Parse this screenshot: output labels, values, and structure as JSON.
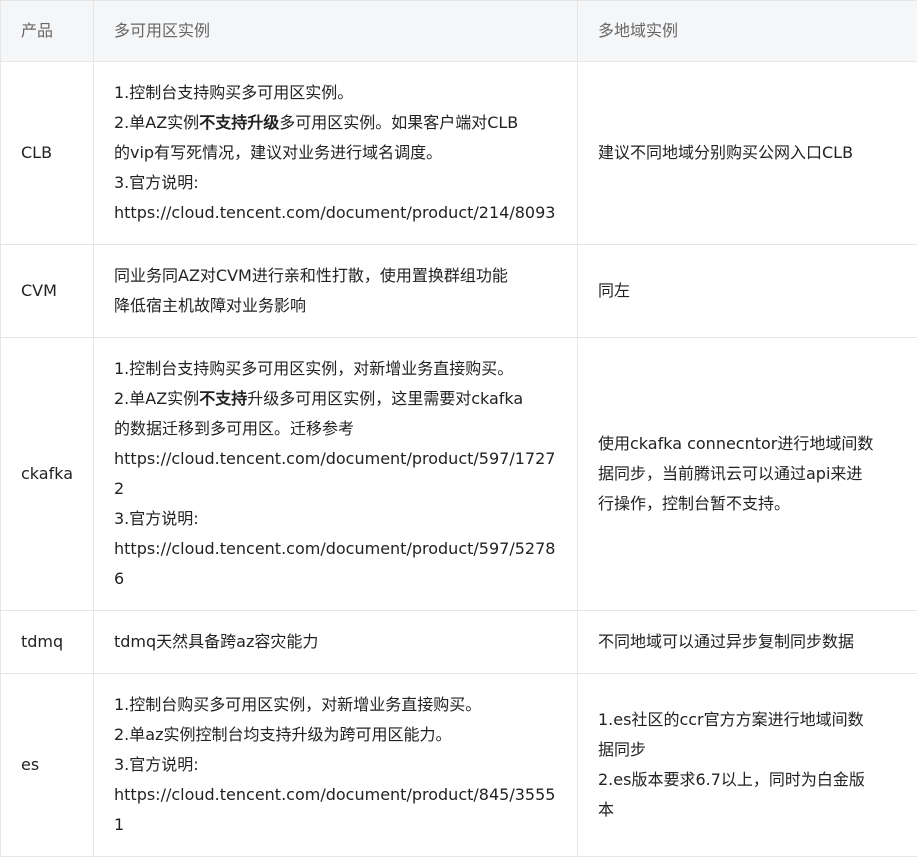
{
  "header": {
    "col_product": "产品",
    "col_multi_az": "多可用区实例",
    "col_multi_region": "多地域实例"
  },
  "rows": [
    {
      "product": "CLB",
      "az_lines": [
        [
          "1.控制台支持购买多可用区实例。"
        ],
        [
          "2.单AZ实例",
          "不支持升级",
          "多可用区实例。如果客户端对CLB"
        ],
        [
          "的vip有写死情况，建议对业务进行域名调度。"
        ],
        [
          "3.官方说明:"
        ],
        [
          "https://cloud.tencent.com/document/product/214/8093"
        ]
      ],
      "region_lines": [
        "建议不同地域分别购买公网入口CLB"
      ]
    },
    {
      "product": "CVM",
      "az_lines": [
        [
          "同业务同AZ对CVM进行亲和性打散，使用置换群组功能"
        ],
        [
          "降低宿主机故障对业务影响"
        ]
      ],
      "region_lines": [
        "同左"
      ]
    },
    {
      "product": "ckafka",
      "az_lines": [
        [
          "1.控制台支持购买多可用区实例，对新增业务直接购买。"
        ],
        [
          "2.单AZ实例",
          "不支持",
          "升级多可用区实例，这里需要对ckafka"
        ],
        [
          "的数据迁移到多可用区。迁移参考"
        ],
        [
          "https://cloud.tencent.com/document/product/597/17272"
        ],
        [
          "3.官方说明:"
        ],
        [
          "https://cloud.tencent.com/document/product/597/52786"
        ]
      ],
      "region_lines": [
        "使用ckafka connecntor进行地域间数",
        "据同步，当前腾讯云可以通过api来进",
        "行操作，控制台暂不支持。"
      ]
    },
    {
      "product": "tdmq",
      "az_lines": [
        [
          "tdmq天然具备跨az容灾能力"
        ]
      ],
      "region_lines": [
        "不同地域可以通过异步复制同步数据"
      ]
    },
    {
      "product": "es",
      "az_lines": [
        [
          "1.控制台购买多可用区实例，对新增业务直接购买。"
        ],
        [
          "2.单az实例控制台均支持升级为跨可用区能力。"
        ],
        [
          "3.官方说明:"
        ],
        [
          "https://cloud.tencent.com/document/product/845/35551"
        ]
      ],
      "region_lines": [
        "1.es社区的ccr官方方案进行地域间数",
        "据同步",
        "2.es版本要求6.7以上，同时为白金版",
        "本"
      ]
    }
  ]
}
